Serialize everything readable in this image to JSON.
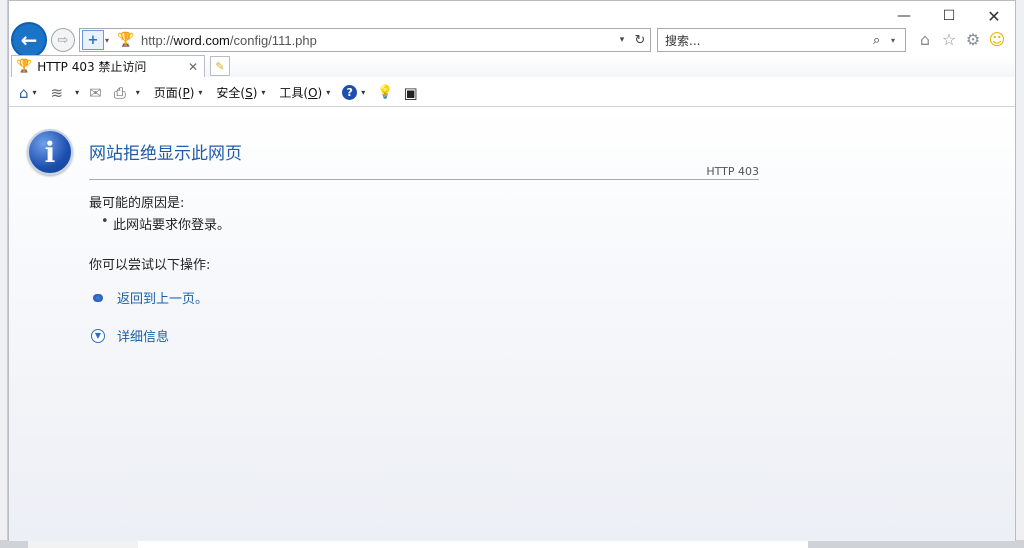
{
  "window": {
    "minimize": "—",
    "maximize": "☐",
    "close": "✕"
  },
  "nav": {
    "back_glyph": "←",
    "forward_glyph": "⇨"
  },
  "address": {
    "shield_glyph": "+",
    "url_prefix": "http://",
    "url_domain": "word.com",
    "url_path": "/config/111.php",
    "refresh_glyph": "↻",
    "dropdown_glyph": "▾"
  },
  "search": {
    "placeholder": "搜索...",
    "icon": "⌕",
    "dropdown_glyph": "▾"
  },
  "right_icons": {
    "home": "⌂",
    "favorites": "☆",
    "settings": "⚙",
    "feedback": "☺"
  },
  "tab": {
    "title": "HTTP 403 禁止访问",
    "close": "✕",
    "new_tab": "✎"
  },
  "commandbar": {
    "home": "⌂",
    "feeds": "≋",
    "mail": "✉",
    "print": "⎙",
    "page_label": "页面(",
    "page_key": "P",
    "page_close": ")",
    "safety_label": "安全(",
    "safety_key": "S",
    "safety_close": ")",
    "tools_label": "工具(",
    "tools_key": "O",
    "tools_close": ")",
    "help": "?",
    "bulb": "💡",
    "research": "▣",
    "dropdown_glyph": "▾"
  },
  "content": {
    "title": "网站拒绝显示此网页",
    "http_code": "HTTP 403",
    "reason_heading": "最可能的原因是:",
    "reasons": [
      "此网站要求你登录。"
    ],
    "try_heading": "你可以尝试以下操作:",
    "back_link": "返回到上一页。",
    "more_info_link": "详细信息",
    "info_glyph": "i",
    "expand_glyph": "▼"
  },
  "colors": {
    "accent": "#1a73c7",
    "link": "#1a5fa8",
    "title": "#1f5ba9"
  }
}
